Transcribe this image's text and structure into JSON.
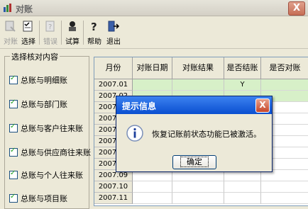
{
  "window": {
    "title": "对账",
    "close_label": "X"
  },
  "toolbar": {
    "items": [
      {
        "label": "对账",
        "icon": "reconcile-icon",
        "disabled": true
      },
      {
        "label": "选择",
        "icon": "select-icon",
        "disabled": false
      },
      {
        "label": "错误",
        "icon": "error-icon",
        "disabled": true
      },
      {
        "label": "试算",
        "icon": "calc-icon",
        "disabled": false
      },
      {
        "label": "帮助",
        "icon": "help-icon",
        "disabled": false
      },
      {
        "label": "退出",
        "icon": "exit-icon",
        "disabled": false
      }
    ]
  },
  "left_panel": {
    "group_label": "选择核对内容",
    "options": [
      {
        "label": "总账与明细账",
        "checked": true
      },
      {
        "label": "总账与部门账",
        "checked": true
      },
      {
        "label": "总账与客户往来账",
        "checked": true
      },
      {
        "label": "总账与供应商往来账",
        "checked": true
      },
      {
        "label": "总账与个人往来账",
        "checked": true
      },
      {
        "label": "总账与项目账",
        "checked": true
      }
    ]
  },
  "grid": {
    "columns": [
      "月份",
      "对账日期",
      "对账结果",
      "是否结账",
      "是否对账"
    ],
    "rows": [
      {
        "month": "2007.01",
        "closed": "Y",
        "highlight": true
      },
      {
        "month": "2007.02",
        "closed": "",
        "highlight": true
      },
      {
        "month": "2007.03",
        "closed": "",
        "highlight": false
      },
      {
        "month": "2007.04",
        "closed": "",
        "highlight": false
      },
      {
        "month": "2007.05",
        "closed": "",
        "highlight": false
      },
      {
        "month": "2007.06",
        "closed": "",
        "highlight": false
      },
      {
        "month": "2007.07",
        "closed": "",
        "highlight": false
      },
      {
        "month": "2007.08",
        "closed": "",
        "highlight": false
      },
      {
        "month": "2007.09",
        "closed": "",
        "highlight": false
      },
      {
        "month": "2007.10",
        "closed": "",
        "highlight": false
      },
      {
        "month": "2007.11",
        "closed": "",
        "highlight": false
      }
    ]
  },
  "dialog": {
    "title": "提示信息",
    "message": "恢复记账前状态功能已被激活。",
    "ok_label": "确定",
    "close_label": "X",
    "icon": "info-icon"
  }
}
